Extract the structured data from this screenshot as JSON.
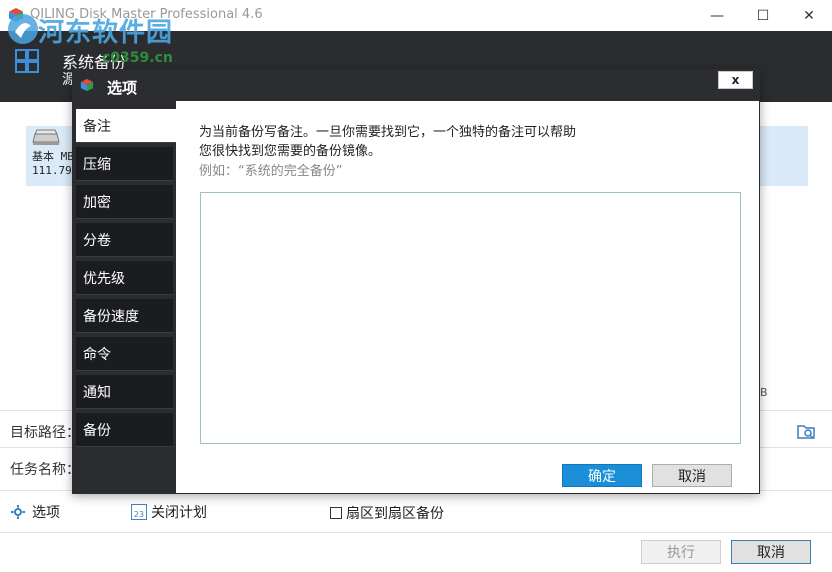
{
  "window": {
    "title": "QILING Disk Master Professional 4.6",
    "minimize": "—",
    "maximize": "☐",
    "close": "✕"
  },
  "watermark": {
    "site_name": "河东软件园",
    "url": "c0359.cn"
  },
  "header": {
    "title": "系统备份",
    "subtitle": "源"
  },
  "source": {
    "disk_label": "基本 MB",
    "disk_size": "111.79",
    "size_unit_fragment": "B"
  },
  "fields": {
    "target_path_label": "目标路径：",
    "task_name_label": "任务名称："
  },
  "options_row": {
    "options_label": "选项",
    "schedule_label": "关闭计划",
    "sector_label": "扇区到扇区备份"
  },
  "bottom_buttons": {
    "execute": "执行",
    "cancel": "取消"
  },
  "modal": {
    "title": "选项",
    "close": "x",
    "sidebar": [
      {
        "label": "备注",
        "active": true
      },
      {
        "label": "压缩",
        "active": false
      },
      {
        "label": "加密",
        "active": false
      },
      {
        "label": "分卷",
        "active": false
      },
      {
        "label": "优先级",
        "active": false
      },
      {
        "label": "备份速度",
        "active": false
      },
      {
        "label": "命令",
        "active": false
      },
      {
        "label": "通知",
        "active": false
      },
      {
        "label": "备份",
        "active": false
      }
    ],
    "note": {
      "line1": "为当前备份写备注。一旦你需要找到它，一个独特的备注可以帮助",
      "line2": "您很快找到您需要的备份镜像。",
      "example": "例如：“系统的完全备份”",
      "value": ""
    },
    "ok": "确定",
    "cancel": "取消"
  },
  "colors": {
    "dark_bar": "#2a2c30",
    "accent_blue": "#1a8fd8",
    "selection_blue": "#daeaf8"
  }
}
